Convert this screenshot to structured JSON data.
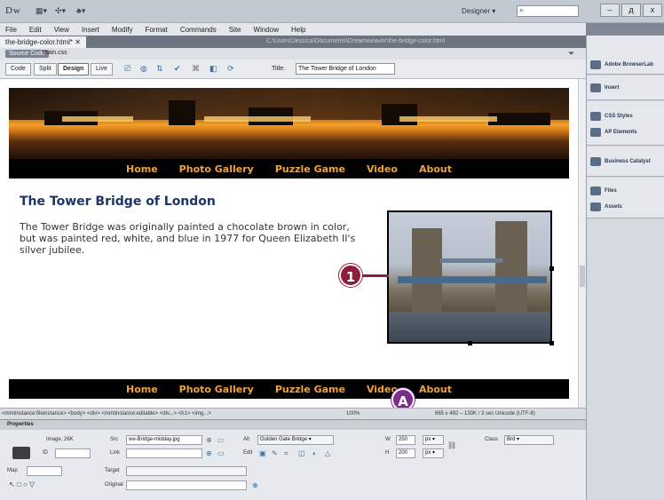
{
  "app": {
    "logo": "Dw",
    "workspace": "Designer",
    "window_controls": [
      "–",
      "д",
      "x"
    ]
  },
  "menu": [
    "File",
    "Edit",
    "View",
    "Insert",
    "Modify",
    "Format",
    "Commands",
    "Site",
    "Window",
    "Help"
  ],
  "document": {
    "tab_name": "the-bridge-color.html*",
    "path": "C:\\Users\\Jessica\\Documents\\Dreamweaver\\the-bridge-color.html",
    "source_code_btn": "Source Code",
    "related_file": "main.css"
  },
  "doc_toolbar": {
    "views": [
      "Code",
      "Split",
      "Design",
      "Live"
    ],
    "title_label": "Title:",
    "title_value": "The Tower Bridge of London"
  },
  "page": {
    "nav": [
      "Home",
      "Photo Gallery",
      "Puzzle Game",
      "Video",
      "About"
    ],
    "heading": "The Tower Bridge of London",
    "paragraph": "The Tower Bridge was originally painted a chocolate brown in color, but was painted red, white, and blue in 1977 for Queen Elizabeth II's silver jubilee."
  },
  "callouts": {
    "one": "1",
    "a": "A"
  },
  "status": {
    "tag_selector": "<mmtinstance:fileinstance> <body> <div> <mmtinstance:editable> <div...> <h1> <img...>",
    "zoom": "100%",
    "dims": "865 x 492 – 130K / 3 sec  Unicode (UTF-8)"
  },
  "properties": {
    "header": "Properties",
    "image_label": "Image, 26K",
    "id_label": "ID",
    "src_label": "Src",
    "src_value": "we-Bridge-midday.jpg",
    "link_label": "Link",
    "alt_label": "Alt",
    "alt_value": "Golden Gate Bridge",
    "edit_label": "Edit",
    "w_label": "W",
    "w_value": "250",
    "h_label": "H",
    "h_value": "200",
    "unit": "px",
    "class_label": "Class",
    "class_value": "Brd",
    "map_label": "Map",
    "target_label": "Target",
    "original_label": "Original"
  },
  "panels": {
    "groups": [
      {
        "items": [
          "Adobe BrowserLab"
        ]
      },
      {
        "items": [
          "Insert"
        ]
      },
      {
        "items": [
          "CSS Styles",
          "AP Elements"
        ]
      },
      {
        "items": [
          "Business Catalyst"
        ]
      },
      {
        "items": [
          "Files",
          "Assets"
        ]
      }
    ]
  },
  "colors": {
    "nav_text": "#f0a23a",
    "heading": "#1f3566",
    "callout": "#8e1d3a"
  }
}
